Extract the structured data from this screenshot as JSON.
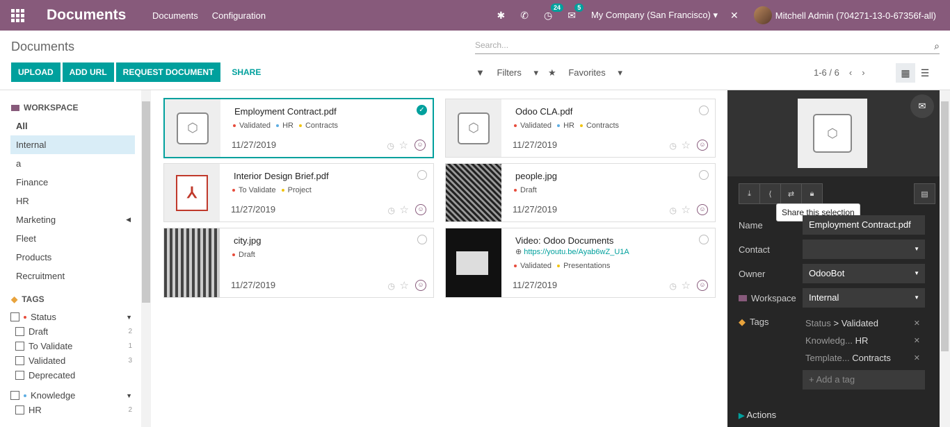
{
  "navbar": {
    "app_title": "Documents",
    "menus": [
      "Documents",
      "Configuration"
    ],
    "activity_count": "24",
    "messages_count": "5",
    "company": "My Company (San Francisco)",
    "user": "Mitchell Admin (704271-13-0-67356f-all)"
  },
  "control_panel": {
    "breadcrumb": "Documents",
    "search_placeholder": "Search...",
    "buttons": {
      "upload": "UPLOAD",
      "add_url": "ADD URL",
      "request": "REQUEST DOCUMENT",
      "share": "SHARE"
    },
    "filters": "Filters",
    "favorites": "Favorites",
    "pager": "1-6 / 6"
  },
  "sidebar": {
    "workspace_header": "WORKSPACE",
    "workspaces": [
      "All",
      "Internal",
      "a",
      "Finance",
      "HR",
      "Marketing",
      "Fleet",
      "Products",
      "Recruitment"
    ],
    "tags_header": "TAGS",
    "status_group": "Status",
    "status_tags": [
      {
        "label": "Draft",
        "count": "2"
      },
      {
        "label": "To Validate",
        "count": "1"
      },
      {
        "label": "Validated",
        "count": "3"
      },
      {
        "label": "Deprecated",
        "count": ""
      }
    ],
    "knowledge_group": "Knowledge",
    "knowledge_tags": [
      {
        "label": "HR",
        "count": "2"
      }
    ]
  },
  "documents": [
    {
      "name": "Employment Contract.pdf",
      "tags": [
        "Validated",
        "HR",
        "Contracts"
      ],
      "date": "11/27/2019"
    },
    {
      "name": "Odoo CLA.pdf",
      "tags": [
        "Validated",
        "HR",
        "Contracts"
      ],
      "date": "11/27/2019"
    },
    {
      "name": "Interior Design Brief.pdf",
      "tags": [
        "To Validate",
        "Project"
      ],
      "date": "11/27/2019"
    },
    {
      "name": "people.jpg",
      "tags": [
        "Draft"
      ],
      "date": "11/27/2019"
    },
    {
      "name": "city.jpg",
      "tags": [
        "Draft"
      ],
      "date": "11/27/2019"
    },
    {
      "name": "Video: Odoo Documents",
      "url": "https://youtu.be/Ayab6wZ_U1A",
      "tags": [
        "Validated",
        "Presentations"
      ],
      "date": "11/27/2019"
    }
  ],
  "tag_colors": {
    "status": "#e74c3c",
    "hr": "#5dade2",
    "contracts": "#f1c40f"
  },
  "inspector": {
    "tooltip": "Share this selection",
    "name_label": "Name",
    "name_value": "Employment Contract.pdf",
    "contact_label": "Contact",
    "contact_value": "",
    "owner_label": "Owner",
    "owner_value": "OdooBot",
    "workspace_label": "Workspace",
    "workspace_value": "Internal",
    "tags_label": "Tags",
    "tags": [
      {
        "facet": "Status",
        "value": "Validated"
      },
      {
        "facet": "Knowledg...",
        "value": "HR"
      },
      {
        "facet": "Template...",
        "value": "Contracts"
      }
    ],
    "add_tag_placeholder": "+ Add a tag",
    "actions_label": "Actions"
  }
}
